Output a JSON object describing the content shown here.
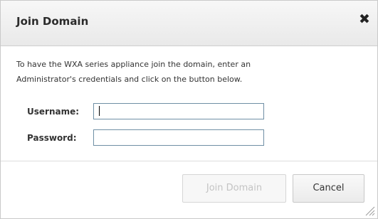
{
  "dialog": {
    "title": "Join Domain",
    "close_icon": "close-icon",
    "message_line1": "To have the WXA series appliance join the domain, enter an",
    "message_line2": "Administrator's credentials and click on the button below.",
    "username_label": "Username:",
    "username_value": "",
    "password_label": "Password:",
    "password_value": "",
    "join_button_label": "Join Domain",
    "cancel_button_label": "Cancel",
    "join_button_enabled": false
  }
}
